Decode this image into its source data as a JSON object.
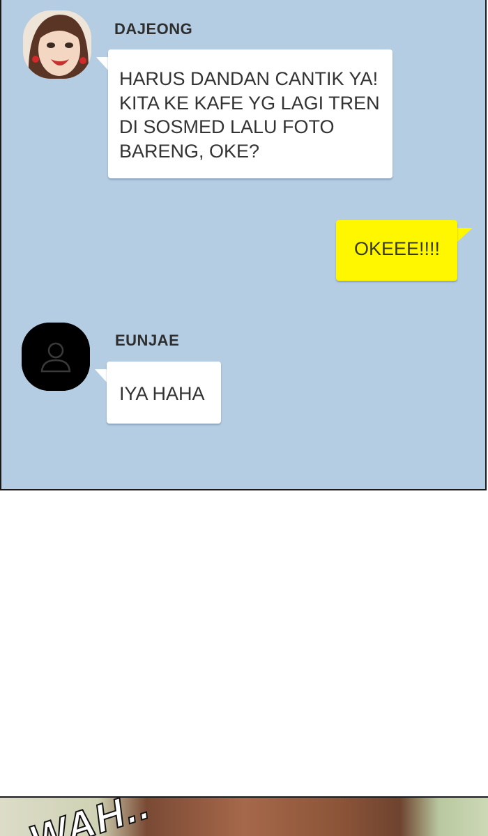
{
  "chat": {
    "messages": [
      {
        "sender": "DAJEONG",
        "text": "HARUS DANDAN CANTIK YA!\nKITA KE KAFE YG LAGI TREN\nDI SOSMED LALU FOTO\nBARENG, OKE?",
        "side": "left",
        "bubble_color": "#ffffff"
      },
      {
        "sender": "",
        "text": "OKEEE!!!!",
        "side": "right",
        "bubble_color": "#fff700"
      },
      {
        "sender": "EUNJAE",
        "text": "IYA HAHA",
        "side": "left",
        "bubble_color": "#ffffff"
      }
    ],
    "avatars": {
      "dajeong": "woman-portrait-avatar",
      "eunjae": "default-person-icon"
    },
    "background_color": "#b5cde3"
  },
  "next_panel": {
    "sound_effect": "WAH.."
  }
}
